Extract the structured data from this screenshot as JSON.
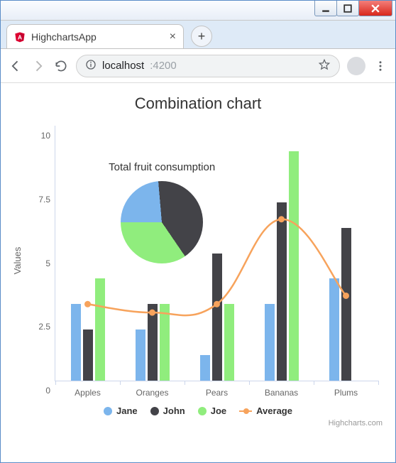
{
  "window": {
    "tab_title": "HighchartsApp",
    "url_host": "localhost",
    "url_port": ":4200"
  },
  "chart_data": {
    "type": "bar",
    "title": "Combination chart",
    "ylabel": "Values",
    "ylim": [
      0,
      10
    ],
    "yticks": [
      0,
      2.5,
      5,
      7.5,
      10
    ],
    "categories": [
      "Apples",
      "Oranges",
      "Pears",
      "Bananas",
      "Plums"
    ],
    "series": [
      {
        "name": "Jane",
        "type": "column",
        "color": "#7cb5ec",
        "values": [
          3,
          2,
          1,
          3,
          4
        ]
      },
      {
        "name": "John",
        "type": "column",
        "color": "#434348",
        "values": [
          2,
          3,
          5,
          7,
          6
        ]
      },
      {
        "name": "Joe",
        "type": "column",
        "color": "#90ed7d",
        "values": [
          4,
          3,
          3,
          9,
          0
        ]
      },
      {
        "name": "Average",
        "type": "spline",
        "color": "#f7a35c",
        "values": [
          3,
          2.67,
          3,
          6.33,
          3.33
        ]
      }
    ],
    "pie": {
      "title": "Total fruit consumption",
      "slices": [
        {
          "name": "Jane",
          "value": 13,
          "color": "#7cb5ec"
        },
        {
          "name": "John",
          "value": 23,
          "color": "#434348"
        },
        {
          "name": "Joe",
          "value": 19,
          "color": "#90ed7d"
        }
      ]
    },
    "credits": "Highcharts.com"
  }
}
